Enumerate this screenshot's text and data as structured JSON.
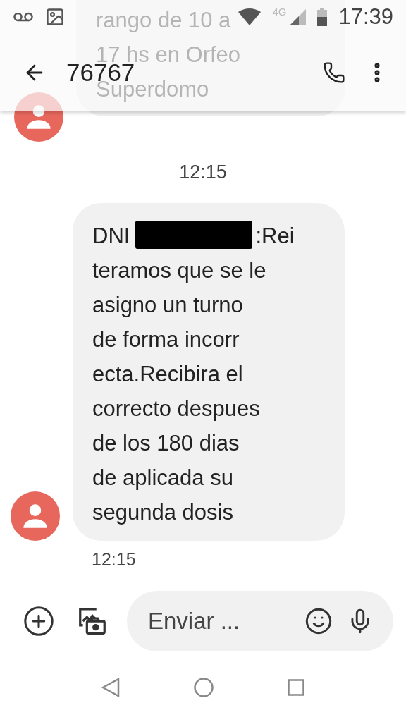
{
  "status_bar": {
    "time": "17:39",
    "network": "4G"
  },
  "header": {
    "title": "76767"
  },
  "previous_message": {
    "lines": [
      "rango de 10 a",
      "17 hs en Orfeo",
      "Superdomo"
    ]
  },
  "timestamp": "12:15",
  "message": {
    "prefix": "DNI",
    "redacted": true,
    "first_line_end": ":Rei",
    "lines": [
      "teramos que se le",
      "asigno un turno",
      "de forma incorr",
      "ecta.Recibira el",
      "correcto despues",
      "de los 180 dias",
      "de aplicada su",
      "segunda dosis"
    ],
    "time": "12:15"
  },
  "composer": {
    "placeholder": "Enviar ..."
  }
}
